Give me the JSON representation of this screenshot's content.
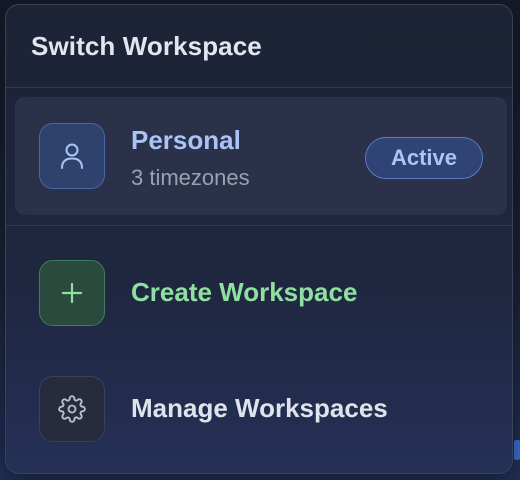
{
  "panel": {
    "title": "Switch Workspace"
  },
  "workspaces": [
    {
      "name": "Personal",
      "subtitle": "3 timezones",
      "badge": "Active",
      "icon": "user-icon"
    }
  ],
  "actions": {
    "create": {
      "label": "Create Workspace",
      "icon": "plus-icon"
    },
    "manage": {
      "label": "Manage Workspaces",
      "icon": "gear-icon"
    }
  },
  "colors": {
    "accent_blue": "#a9c4f7",
    "accent_green": "#8fe0a0",
    "panel_bg": "#1d2335",
    "active_row_bg": "#2a3148"
  }
}
